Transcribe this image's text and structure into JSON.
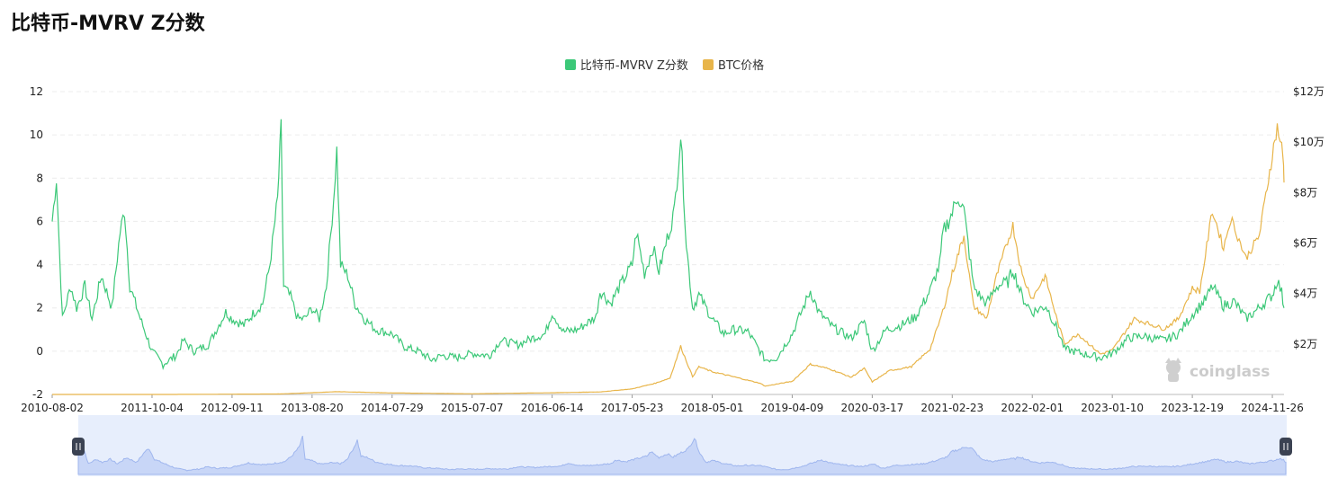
{
  "page": {
    "title": "比特币-MVRV Z分数"
  },
  "legend": {
    "items": [
      {
        "label": "比特币-MVRV Z分数",
        "color": "#3cc878"
      },
      {
        "label": "BTC价格",
        "color": "#e8b54a"
      }
    ]
  },
  "watermark": {
    "text": "coinglass"
  },
  "chart_data": {
    "type": "line",
    "title": "比特币-MVRV Z分数",
    "x_tick_labels": [
      "2010-08-02",
      "2011-10-04",
      "2012-09-11",
      "2013-08-20",
      "2014-07-29",
      "2015-07-07",
      "2016-06-14",
      "2017-05-23",
      "2018-05-01",
      "2019-04-09",
      "2020-03-17",
      "2021-02-23",
      "2022-02-01",
      "2023-01-10",
      "2023-12-19",
      "2024-11-26"
    ],
    "x_range": [
      "2010-08-02",
      "2025-01-15"
    ],
    "y_left": {
      "ticks": [
        "12",
        "10",
        "8",
        "6",
        "4",
        "2",
        "0",
        "-2"
      ],
      "min": -2,
      "max": 12
    },
    "y_right": {
      "ticks": [
        "$12万",
        "$10万",
        "$8万",
        "$6万",
        "$4万",
        "$2万"
      ],
      "min": 0,
      "max": 120000
    },
    "grid": true,
    "legend_position": "top-center",
    "series": [
      {
        "name": "比特币-MVRV Z分数",
        "axis": "left",
        "color": "#3cc878",
        "points": [
          [
            "2010-08-02",
            6.0
          ],
          [
            "2010-08-20",
            8.0
          ],
          [
            "2010-09-15",
            1.5
          ],
          [
            "2010-10-20",
            3.0
          ],
          [
            "2010-11-15",
            2.0
          ],
          [
            "2010-12-20",
            3.0
          ],
          [
            "2011-01-20",
            1.5
          ],
          [
            "2011-03-01",
            3.5
          ],
          [
            "2011-04-15",
            2.0
          ],
          [
            "2011-05-20",
            5.5
          ],
          [
            "2011-06-08",
            6.5
          ],
          [
            "2011-07-01",
            3.0
          ],
          [
            "2011-08-15",
            1.5
          ],
          [
            "2011-10-04",
            0.0
          ],
          [
            "2011-11-20",
            -0.6
          ],
          [
            "2012-01-15",
            -0.2
          ],
          [
            "2012-02-15",
            0.5
          ],
          [
            "2012-04-01",
            0.0
          ],
          [
            "2012-06-01",
            0.3
          ],
          [
            "2012-08-15",
            1.8
          ],
          [
            "2012-09-11",
            1.5
          ],
          [
            "2012-11-01",
            1.2
          ],
          [
            "2012-12-15",
            1.8
          ],
          [
            "2013-01-20",
            2.2
          ],
          [
            "2013-02-20",
            4.0
          ],
          [
            "2013-03-25",
            7.0
          ],
          [
            "2013-04-09",
            10.3
          ],
          [
            "2013-04-20",
            3.0
          ],
          [
            "2013-05-20",
            2.5
          ],
          [
            "2013-06-20",
            1.5
          ],
          [
            "2013-07-20",
            1.5
          ],
          [
            "2013-08-20",
            2.0
          ],
          [
            "2013-09-20",
            1.5
          ],
          [
            "2013-10-20",
            3.0
          ],
          [
            "2013-11-20",
            7.0
          ],
          [
            "2013-12-04",
            9.3
          ],
          [
            "2013-12-20",
            4.0
          ],
          [
            "2014-01-20",
            3.5
          ],
          [
            "2014-02-20",
            2.2
          ],
          [
            "2014-04-01",
            1.5
          ],
          [
            "2014-05-20",
            1.0
          ],
          [
            "2014-07-29",
            0.8
          ],
          [
            "2014-09-20",
            0.2
          ],
          [
            "2014-11-20",
            0.0
          ],
          [
            "2015-01-14",
            -0.4
          ],
          [
            "2015-03-01",
            -0.2
          ],
          [
            "2015-05-01",
            -0.3
          ],
          [
            "2015-07-07",
            -0.1
          ],
          [
            "2015-09-20",
            -0.2
          ],
          [
            "2015-11-05",
            0.5
          ],
          [
            "2016-01-20",
            0.3
          ],
          [
            "2016-03-20",
            0.6
          ],
          [
            "2016-05-15",
            0.8
          ],
          [
            "2016-06-14",
            1.8
          ],
          [
            "2016-08-01",
            0.9
          ],
          [
            "2016-10-01",
            1.0
          ],
          [
            "2016-12-20",
            1.6
          ],
          [
            "2017-01-05",
            2.8
          ],
          [
            "2017-02-20",
            2.2
          ],
          [
            "2017-03-20",
            2.8
          ],
          [
            "2017-05-23",
            4.0
          ],
          [
            "2017-06-10",
            5.5
          ],
          [
            "2017-07-15",
            3.6
          ],
          [
            "2017-08-20",
            4.8
          ],
          [
            "2017-09-15",
            3.7
          ],
          [
            "2017-10-20",
            5.2
          ],
          [
            "2017-11-20",
            6.5
          ],
          [
            "2017-12-17",
            10.0
          ],
          [
            "2018-01-10",
            5.0
          ],
          [
            "2018-02-06",
            2.0
          ],
          [
            "2018-03-05",
            2.6
          ],
          [
            "2018-05-01",
            1.5
          ],
          [
            "2018-06-20",
            0.8
          ],
          [
            "2018-08-01",
            1.0
          ],
          [
            "2018-10-01",
            0.9
          ],
          [
            "2018-12-15",
            -0.4
          ],
          [
            "2019-02-01",
            -0.3
          ],
          [
            "2019-04-09",
            0.8
          ],
          [
            "2019-06-26",
            2.8
          ],
          [
            "2019-08-01",
            1.8
          ],
          [
            "2019-10-01",
            1.1
          ],
          [
            "2019-12-17",
            0.6
          ],
          [
            "2020-02-12",
            1.4
          ],
          [
            "2020-03-17",
            0.0
          ],
          [
            "2020-05-15",
            1.0
          ],
          [
            "2020-07-20",
            1.2
          ],
          [
            "2020-09-20",
            1.6
          ],
          [
            "2020-11-20",
            2.8
          ],
          [
            "2020-12-31",
            4.0
          ],
          [
            "2021-01-15",
            5.5
          ],
          [
            "2021-02-23",
            6.4
          ],
          [
            "2021-03-20",
            7.2
          ],
          [
            "2021-04-14",
            6.5
          ],
          [
            "2021-05-25",
            3.0
          ],
          [
            "2021-06-25",
            2.5
          ],
          [
            "2021-07-20",
            2.2
          ],
          [
            "2021-09-01",
            3.0
          ],
          [
            "2021-10-20",
            3.2
          ],
          [
            "2021-11-10",
            3.8
          ],
          [
            "2021-12-20",
            2.5
          ],
          [
            "2022-02-01",
            1.8
          ],
          [
            "2022-04-01",
            2.1
          ],
          [
            "2022-05-20",
            1.0
          ],
          [
            "2022-06-20",
            0.1
          ],
          [
            "2022-09-01",
            -0.1
          ],
          [
            "2022-11-20",
            -0.3
          ],
          [
            "2023-01-10",
            -0.1
          ],
          [
            "2023-03-20",
            0.6
          ],
          [
            "2023-05-20",
            0.7
          ],
          [
            "2023-08-20",
            0.5
          ],
          [
            "2023-10-20",
            0.8
          ],
          [
            "2023-12-19",
            1.7
          ],
          [
            "2024-02-15",
            2.4
          ],
          [
            "2024-03-14",
            3.0
          ],
          [
            "2024-05-01",
            2.1
          ],
          [
            "2024-06-15",
            2.3
          ],
          [
            "2024-08-05",
            1.5
          ],
          [
            "2024-09-20",
            1.9
          ],
          [
            "2024-11-26",
            2.6
          ],
          [
            "2024-12-17",
            3.3
          ],
          [
            "2025-01-05",
            2.7
          ],
          [
            "2025-01-15",
            2.0
          ]
        ]
      },
      {
        "name": "BTC价格",
        "axis": "right",
        "color": "#e8b54a",
        "points": [
          [
            "2010-08-02",
            0
          ],
          [
            "2012-01-01",
            10
          ],
          [
            "2013-04-09",
            200
          ],
          [
            "2013-12-04",
            1100
          ],
          [
            "2014-07-29",
            600
          ],
          [
            "2015-07-07",
            270
          ],
          [
            "2016-06-14",
            680
          ],
          [
            "2017-01-05",
            1000
          ],
          [
            "2017-05-23",
            2200
          ],
          [
            "2017-09-01",
            4500
          ],
          [
            "2017-11-01",
            6500
          ],
          [
            "2017-12-17",
            19000
          ],
          [
            "2018-02-06",
            7000
          ],
          [
            "2018-03-05",
            11000
          ],
          [
            "2018-05-01",
            9000
          ],
          [
            "2018-08-01",
            7000
          ],
          [
            "2018-11-20",
            4500
          ],
          [
            "2018-12-15",
            3300
          ],
          [
            "2019-04-09",
            5200
          ],
          [
            "2019-06-26",
            12000
          ],
          [
            "2019-09-20",
            10000
          ],
          [
            "2019-12-17",
            6800
          ],
          [
            "2020-02-12",
            10300
          ],
          [
            "2020-03-17",
            5000
          ],
          [
            "2020-06-01",
            9500
          ],
          [
            "2020-09-01",
            11000
          ],
          [
            "2020-11-20",
            18000
          ],
          [
            "2020-12-31",
            29000
          ],
          [
            "2021-01-20",
            35000
          ],
          [
            "2021-02-23",
            48000
          ],
          [
            "2021-04-14",
            63000
          ],
          [
            "2021-05-25",
            35000
          ],
          [
            "2021-07-20",
            30000
          ],
          [
            "2021-09-01",
            47000
          ],
          [
            "2021-11-10",
            67000
          ],
          [
            "2021-12-20",
            47000
          ],
          [
            "2022-02-01",
            38000
          ],
          [
            "2022-03-28",
            47000
          ],
          [
            "2022-05-20",
            29000
          ],
          [
            "2022-06-20",
            20000
          ],
          [
            "2022-08-15",
            24000
          ],
          [
            "2022-11-20",
            16000
          ],
          [
            "2023-01-10",
            17500
          ],
          [
            "2023-04-14",
            30000
          ],
          [
            "2023-08-20",
            26000
          ],
          [
            "2023-10-20",
            30000
          ],
          [
            "2023-12-19",
            42000
          ],
          [
            "2024-01-20",
            41000
          ],
          [
            "2024-03-14",
            73000
          ],
          [
            "2024-05-01",
            58000
          ],
          [
            "2024-06-01",
            70000
          ],
          [
            "2024-08-05",
            54000
          ],
          [
            "2024-10-01",
            63000
          ],
          [
            "2024-11-26",
            95000
          ],
          [
            "2024-12-17",
            106000
          ],
          [
            "2025-01-05",
            98000
          ],
          [
            "2025-01-13",
            91000
          ],
          [
            "2025-01-15",
            84000
          ]
        ]
      }
    ]
  }
}
